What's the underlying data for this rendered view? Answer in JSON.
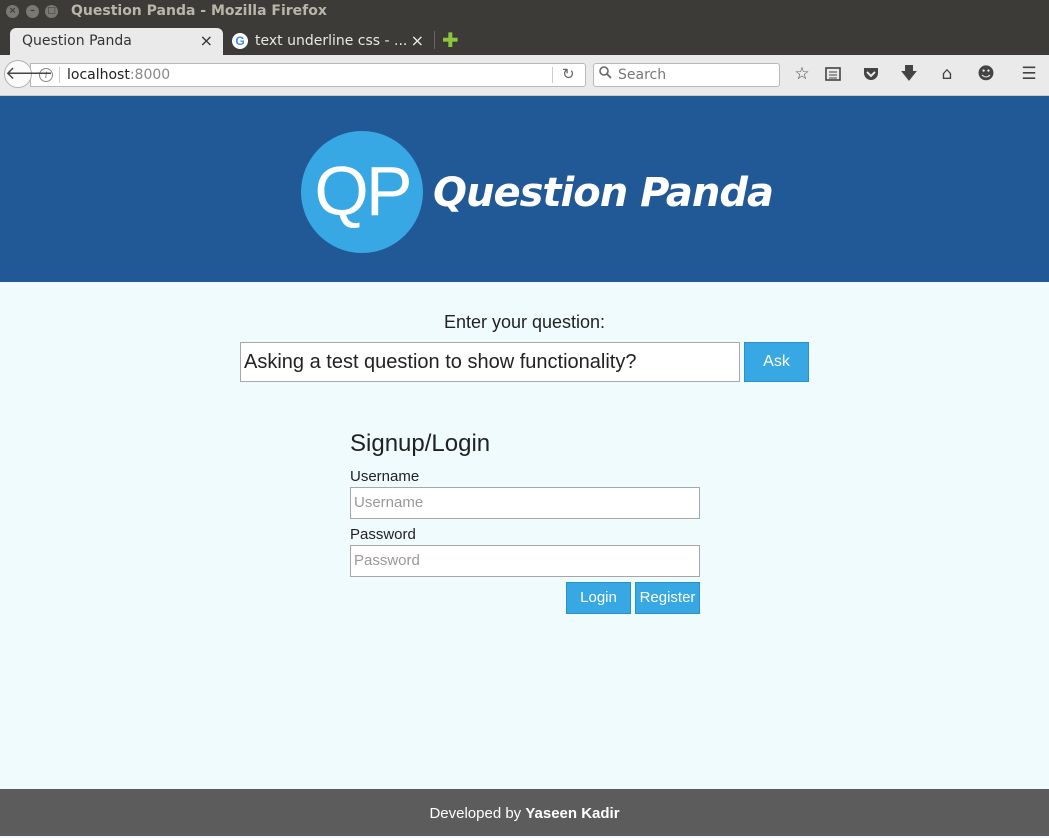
{
  "window": {
    "title": "Question Panda - Mozilla Firefox"
  },
  "tabs": [
    {
      "label": "Question Panda",
      "active": true
    },
    {
      "label": "text underline css - ...",
      "active": false
    }
  ],
  "navbar": {
    "url_host": "localhost",
    "url_port": ":8000",
    "search_placeholder": "Search"
  },
  "header": {
    "logo_initials": "QP",
    "logo_text": "Question Panda",
    "background": "#215896",
    "accent": "#37a8e3"
  },
  "question": {
    "prompt": "Enter your question:",
    "value": "Asking a test question to show functionality?",
    "ask_label": "Ask"
  },
  "login": {
    "title": "Signup/Login",
    "username_label": "Username",
    "username_placeholder": "Username",
    "password_label": "Password",
    "password_placeholder": "Password",
    "login_label": "Login",
    "register_label": "Register"
  },
  "footer": {
    "prefix": "Developed by ",
    "author": "Yaseen Kadir"
  },
  "icons": {
    "back": "back-arrow-icon",
    "info": "info-icon",
    "reload": "reload-icon",
    "search": "search-icon",
    "bookmark": "star-icon",
    "reading": "reading-list-icon",
    "pocket": "pocket-icon",
    "download": "download-icon",
    "home": "home-icon",
    "emoji": "smiley-icon",
    "menu": "hamburger-menu-icon"
  }
}
